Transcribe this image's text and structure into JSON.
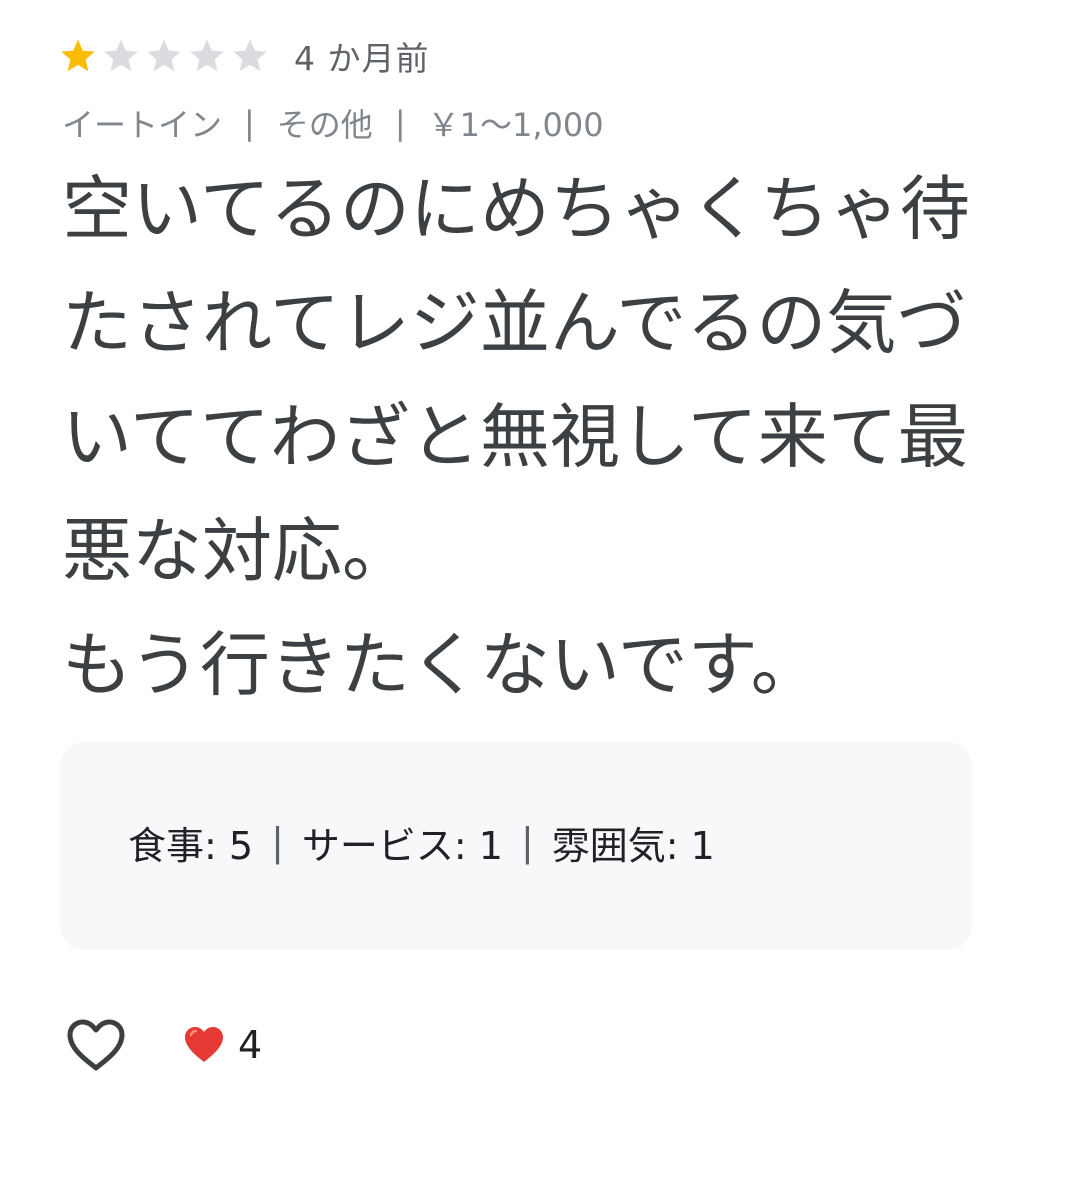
{
  "review": {
    "rating": {
      "value": 1,
      "max": 5,
      "filled_color": "#fbbc04",
      "empty_color": "#dadce0"
    },
    "age": "4 か月前",
    "meta": {
      "dining_type": "イートイン",
      "meal_type": "その他",
      "price_range": "￥1～1,000",
      "separator": "|"
    },
    "text": "空いてるのにめちゃくちゃ待たされてレジ並んでるの気づいててわざと無視して来て最悪な対応。\nもう行きたくないです。",
    "sub_ratings": {
      "food": "食事: 5",
      "service": "サービス: 1",
      "atmosphere": "雰囲気: 1",
      "separator": "|"
    },
    "actions": {
      "like_icon": "heart-outline-icon",
      "reaction_icon": "red-heart-emoji",
      "reaction_count": "4"
    }
  }
}
